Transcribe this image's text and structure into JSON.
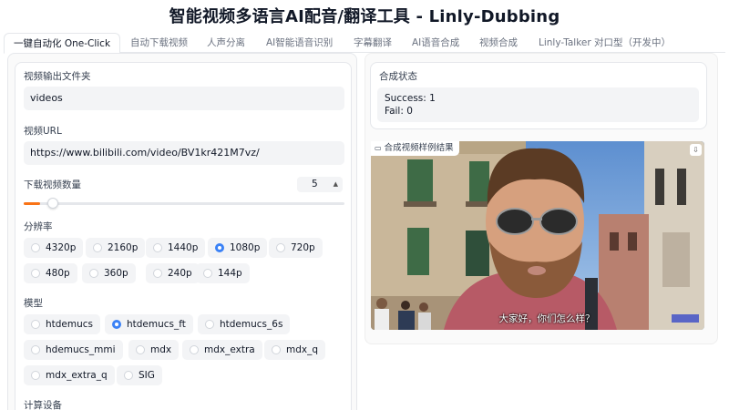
{
  "app": {
    "title": "智能视频多语言AI配音/翻译工具 - Linly-Dubbing"
  },
  "tabs": [
    {
      "label": "一键自动化 One-Click",
      "active": true
    },
    {
      "label": "自动下载视频"
    },
    {
      "label": "人声分离"
    },
    {
      "label": "AI智能语音识别"
    },
    {
      "label": "字幕翻译"
    },
    {
      "label": "AI语音合成"
    },
    {
      "label": "视频合成"
    },
    {
      "label": "Linly-Talker 对口型（开发中）"
    }
  ],
  "form": {
    "output_folder": {
      "label": "视频输出文件夹",
      "value": "videos"
    },
    "video_url": {
      "label": "视频URL",
      "value": "https://www.bilibili.com/video/BV1kr421M7vz/"
    },
    "download_count": {
      "label": "下载视频数量",
      "value": "5",
      "slider_fraction": 0.05
    },
    "resolution": {
      "label": "分辨率",
      "options": [
        "4320p",
        "2160p",
        "1440p",
        "1080p",
        "720p",
        "480p",
        "360p",
        "240p",
        "144p"
      ],
      "selected": "1080p"
    },
    "model": {
      "label": "模型",
      "options": [
        "htdemucs",
        "htdemucs_ft",
        "htdemucs_6s",
        "hdemucs_mmi",
        "mdx",
        "mdx_extra",
        "mdx_q",
        "mdx_extra_q",
        "SIG"
      ],
      "selected": "htdemucs_ft"
    },
    "device": {
      "label": "计算设备"
    }
  },
  "status": {
    "label": "合成状态",
    "lines": [
      "Success: 1",
      "Fail: 0"
    ]
  },
  "video": {
    "label": "合成视频样例结果",
    "subtitle": "大家好，你们怎么样？"
  },
  "colors": {
    "accent": "#f97316",
    "radio_checked": "#3b82f6"
  }
}
